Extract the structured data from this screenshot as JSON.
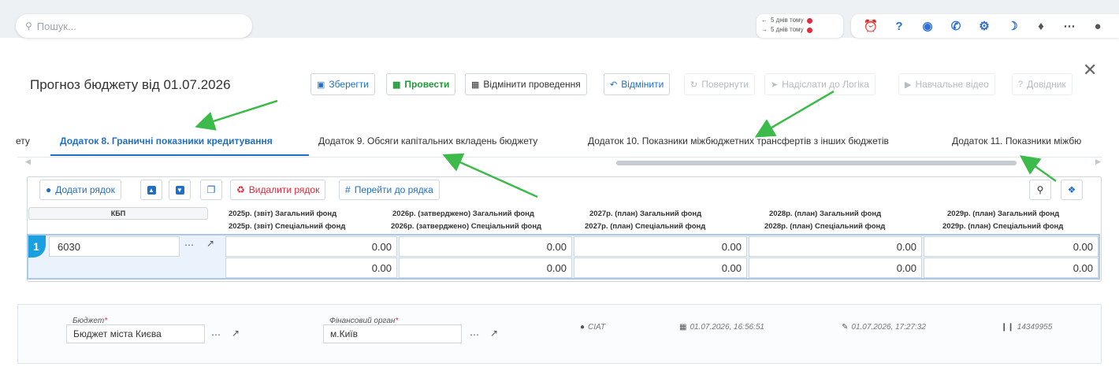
{
  "search": {
    "placeholder": "Пошук..."
  },
  "history": [
    {
      "label": "5 днів тому"
    },
    {
      "label": "5 днів тому"
    }
  ],
  "toolbar_icons": [
    "alarm-icon",
    "help-icon",
    "headset-icon",
    "phone-icon",
    "gear-icon",
    "moon-icon",
    "bell-icon",
    "apps-grid-icon",
    "user-icon"
  ],
  "doc": {
    "title": "Прогноз бюджету від 01.07.2026"
  },
  "actions": {
    "save": "Зберегти",
    "post": "Провести",
    "unpost": "Відмінити проведення",
    "cancel": "Відмінити",
    "return": "Повернути",
    "send_logic": "Надіслати до Логіка",
    "video": "Навчальне відео",
    "help": "Довідник"
  },
  "tabs": [
    {
      "label": "ету"
    },
    {
      "label": "Додаток 8. Граничні показники кредитування"
    },
    {
      "label": "Додаток 9. Обсяги капітальних вкладень бюджету"
    },
    {
      "label": "Додаток 10. Показники міжбюджетних трансфертів з інших бюджетів"
    },
    {
      "label": "Додаток 11. Показники міжбю"
    }
  ],
  "grid_toolbar": {
    "add_row": "Додати рядок",
    "delete_row": "Видалити рядок",
    "goto_row": "Перейти до рядка"
  },
  "grid": {
    "kbp_header": "КБП",
    "columns": [
      {
        "top": "2025р. (звіт) Загальний фонд",
        "bottom": "2025р. (звіт) Спеціальний фонд"
      },
      {
        "top": "2026р. (затверджено) Загальний фонд",
        "bottom": "2026р. (затверджено) Спеціальний фонд"
      },
      {
        "top": "2027р. (план) Загальний фонд",
        "bottom": "2027р. (план) Спеціальний фонд"
      },
      {
        "top": "2028р. (план) Загальний фонд",
        "bottom": "2028р. (план) Спеціальний фонд"
      },
      {
        "top": "2029р. (план) Загальний фонд",
        "bottom": "2029р. (план) Спеціальний фонд"
      }
    ],
    "row_number": "1",
    "kbp_value": "6030",
    "general_values": [
      "0.00",
      "0.00",
      "0.00",
      "0.00",
      "0.00"
    ],
    "special_values": [
      "0.00",
      "0.00",
      "0.00",
      "0.00",
      "0.00"
    ]
  },
  "footer": {
    "budget_label": "Бюджет",
    "budget_value": "Бюджет міста Києва",
    "fin_label": "Фінансовий орган",
    "fin_value": "м.Київ",
    "author": "CIAT",
    "created": "01.07.2026, 16:56:51",
    "modified": "01.07.2026, 17:27:32",
    "doc_id": "14349955"
  },
  "colors": {
    "accent": "#1f6fc9",
    "success": "#1f9a36",
    "danger": "#d8283a",
    "annotation_arrow": "#3dbb4a"
  }
}
